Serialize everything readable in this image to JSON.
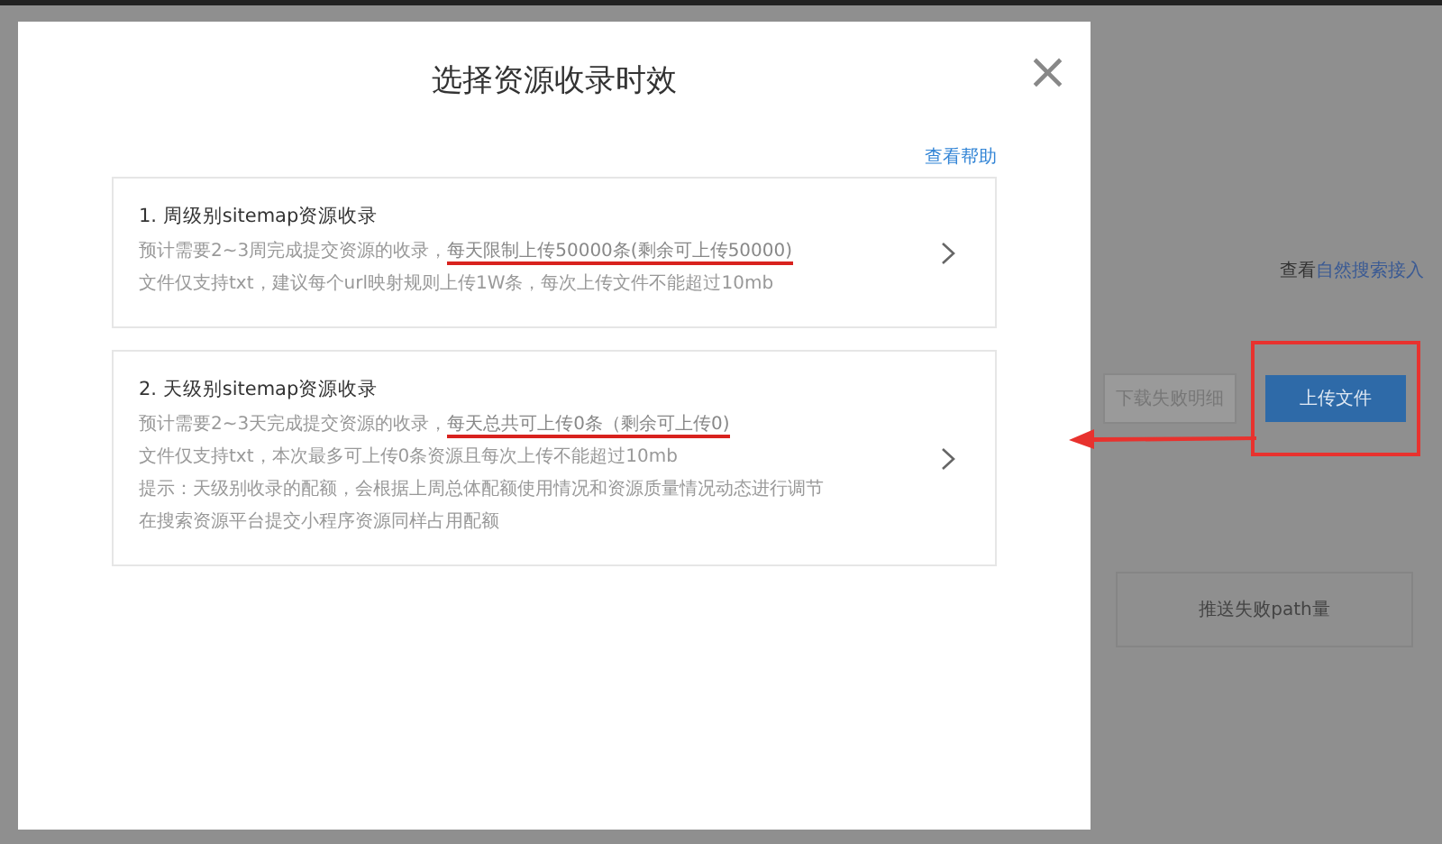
{
  "background": {
    "link_prefix": "查看",
    "link": "自然搜索接入",
    "download_button": "下载失败明细",
    "upload_button": "上传文件",
    "table_header": "推送失败path量"
  },
  "dialog": {
    "title": "选择资源收录时效",
    "close": "×",
    "help_link": "查看帮助",
    "options": [
      {
        "title": "1. 周级别sitemap资源收录",
        "lines": [
          [
            {
              "text": "预计需要2~3周完成提交资源的收录，",
              "underlined": false
            },
            {
              "text": "每天限制上传50000条(剩余可上传50000)",
              "underlined": true
            }
          ],
          [
            {
              "text": "文件仅支持txt，建议每个url映射规则上传1W条，每次上传文件不能超过10mb",
              "underlined": false
            }
          ]
        ]
      },
      {
        "title": "2. 天级别sitemap资源收录",
        "lines": [
          [
            {
              "text": "预计需要2~3天完成提交资源的收录，",
              "underlined": false
            },
            {
              "text": "每天总共可上传0条（剩余可上传0)",
              "underlined": true
            }
          ],
          [
            {
              "text": "文件仅支持txt，本次最多可上传0条资源且每次上传不能超过10mb",
              "underlined": false
            }
          ],
          [
            {
              "text": "提示：天级别收录的配额，会根据上周总体配额使用情况和资源质量情况动态进行调节",
              "underlined": false
            }
          ],
          [
            {
              "text": "在搜索资源平台提交小程序资源同样占用配额",
              "underlined": false
            }
          ]
        ]
      }
    ]
  }
}
